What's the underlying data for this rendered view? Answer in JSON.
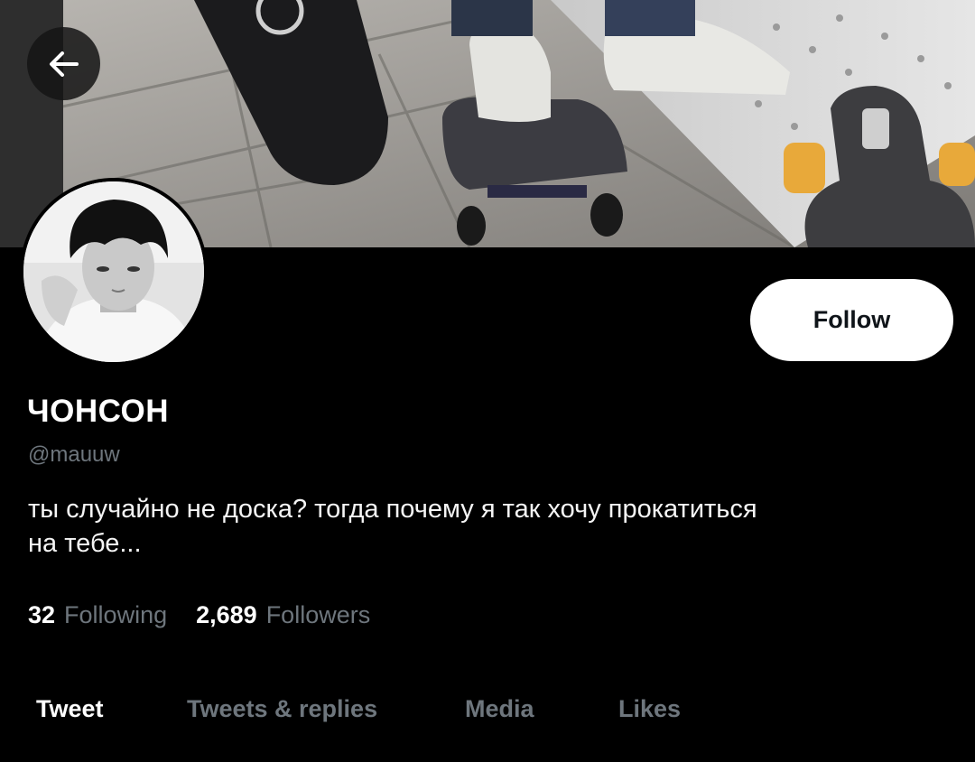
{
  "profile": {
    "display_name": "ЧОНСОН",
    "handle": "@mauuw",
    "bio_line1": "ты случайно не доска? тогда почему я так хочу прокатиться",
    "bio_line2": "на тебе..."
  },
  "actions": {
    "follow_label": "Follow"
  },
  "stats": {
    "following_count": "32",
    "following_label": "Following",
    "followers_count": "2,689",
    "followers_label": "Followers"
  },
  "tabs": [
    {
      "label": "Tweet",
      "active": true
    },
    {
      "label": "Tweets & replies",
      "active": false
    },
    {
      "label": "Media",
      "active": false
    },
    {
      "label": "Likes",
      "active": false
    }
  ],
  "icons": {
    "back": "arrow-left-icon"
  },
  "colors": {
    "background": "#000000",
    "muted_text": "#6e767d",
    "follow_button_bg": "#ffffff",
    "follow_button_text": "#0f1419"
  }
}
